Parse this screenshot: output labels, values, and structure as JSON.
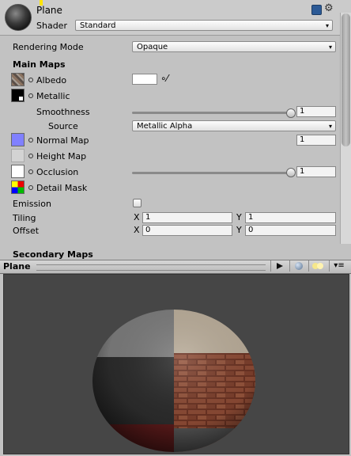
{
  "header": {
    "title": "Plane",
    "shader_label": "Shader",
    "shader_value": "Standard"
  },
  "rendering_mode": {
    "label": "Rendering Mode",
    "value": "Opaque"
  },
  "main_maps": {
    "heading": "Main Maps",
    "albedo": "Albedo",
    "metallic": "Metallic",
    "smoothness": {
      "label": "Smoothness",
      "value": "1",
      "level": 1.0
    },
    "source": {
      "label": "Source",
      "value": "Metallic Alpha"
    },
    "normal_map": {
      "label": "Normal Map",
      "value": "1"
    },
    "height_map": "Height Map",
    "occlusion": {
      "label": "Occlusion",
      "value": "1",
      "level": 1.0
    },
    "detail_mask": "Detail Mask",
    "emission": "Emission",
    "tiling": {
      "label": "Tiling",
      "x_label": "X",
      "x": "1",
      "y_label": "Y",
      "y": "1"
    },
    "offset": {
      "label": "Offset",
      "x_label": "X",
      "x": "0",
      "y_label": "Y",
      "y": "0"
    }
  },
  "secondary_maps": {
    "heading": "Secondary Maps"
  },
  "preview": {
    "title": "Plane"
  },
  "colors": {
    "normal_swatch": "#8080ff",
    "albedo_color": "#ffffff",
    "preview_bg": "#464646"
  }
}
